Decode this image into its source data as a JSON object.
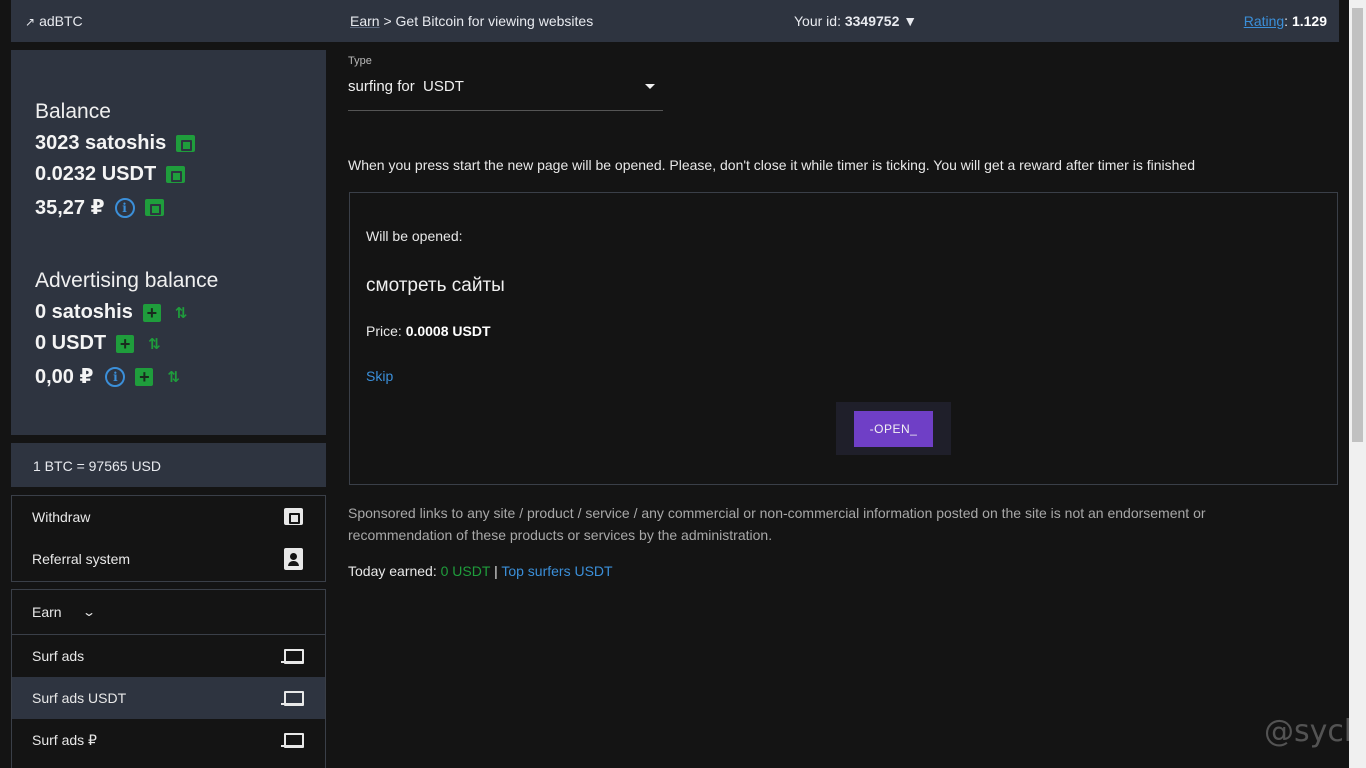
{
  "header": {
    "logo": "adBTC",
    "breadcrumb_earn": "Earn",
    "breadcrumb_sep": ">",
    "breadcrumb_page": "Get Bitcoin for viewing websites",
    "user_id_label": "Your id:",
    "user_id": "3349752",
    "rating_label": "Rating",
    "rating_value": "1.129"
  },
  "balance": {
    "title": "Balance",
    "satoshis": "3023 satoshis",
    "usdt": "0.0232 USDT",
    "rub": "35,27 ₽"
  },
  "ad_balance": {
    "title": "Advertising balance",
    "satoshis": "0 satoshis",
    "usdt": "0 USDT",
    "rub": "0,00 ₽"
  },
  "rate": "1 BTC = 97565 USD",
  "menu": {
    "withdraw": "Withdraw",
    "referral": "Referral system",
    "earn": "Earn",
    "surf_ads": "Surf ads",
    "surf_ads_usdt": "Surf ads USDT",
    "surf_ads_rub": "Surf ads ₽"
  },
  "main": {
    "type_label": "Type",
    "type_value": "surfing for  USDT",
    "notice": "When you press start the new page will be opened. Please, don't close it while timer is ticking. You will get a reward after timer is finished",
    "will_open": "Will be opened:",
    "site_title": "смотреть сайты",
    "price_label": "Price:",
    "price_value": "0.0008 USDT",
    "skip": "Skip",
    "open_button": "-OPEN_",
    "sponsored": "Sponsored links to any site / product / service / any commercial or non-commercial information posted on the site is not an endorsement or recommendation of these products or services by the administration.",
    "today_label": "Today earned:",
    "today_value": "0 USDT",
    "divider": "|",
    "top_surfers": "Top surfers USDT"
  },
  "watermark": "@sych",
  "colors": {
    "background": "#141414",
    "panel": "#2e3440",
    "green": "#1f9d3c",
    "link_blue": "#3b8fd9",
    "button_purple": "#6f3fc6"
  }
}
